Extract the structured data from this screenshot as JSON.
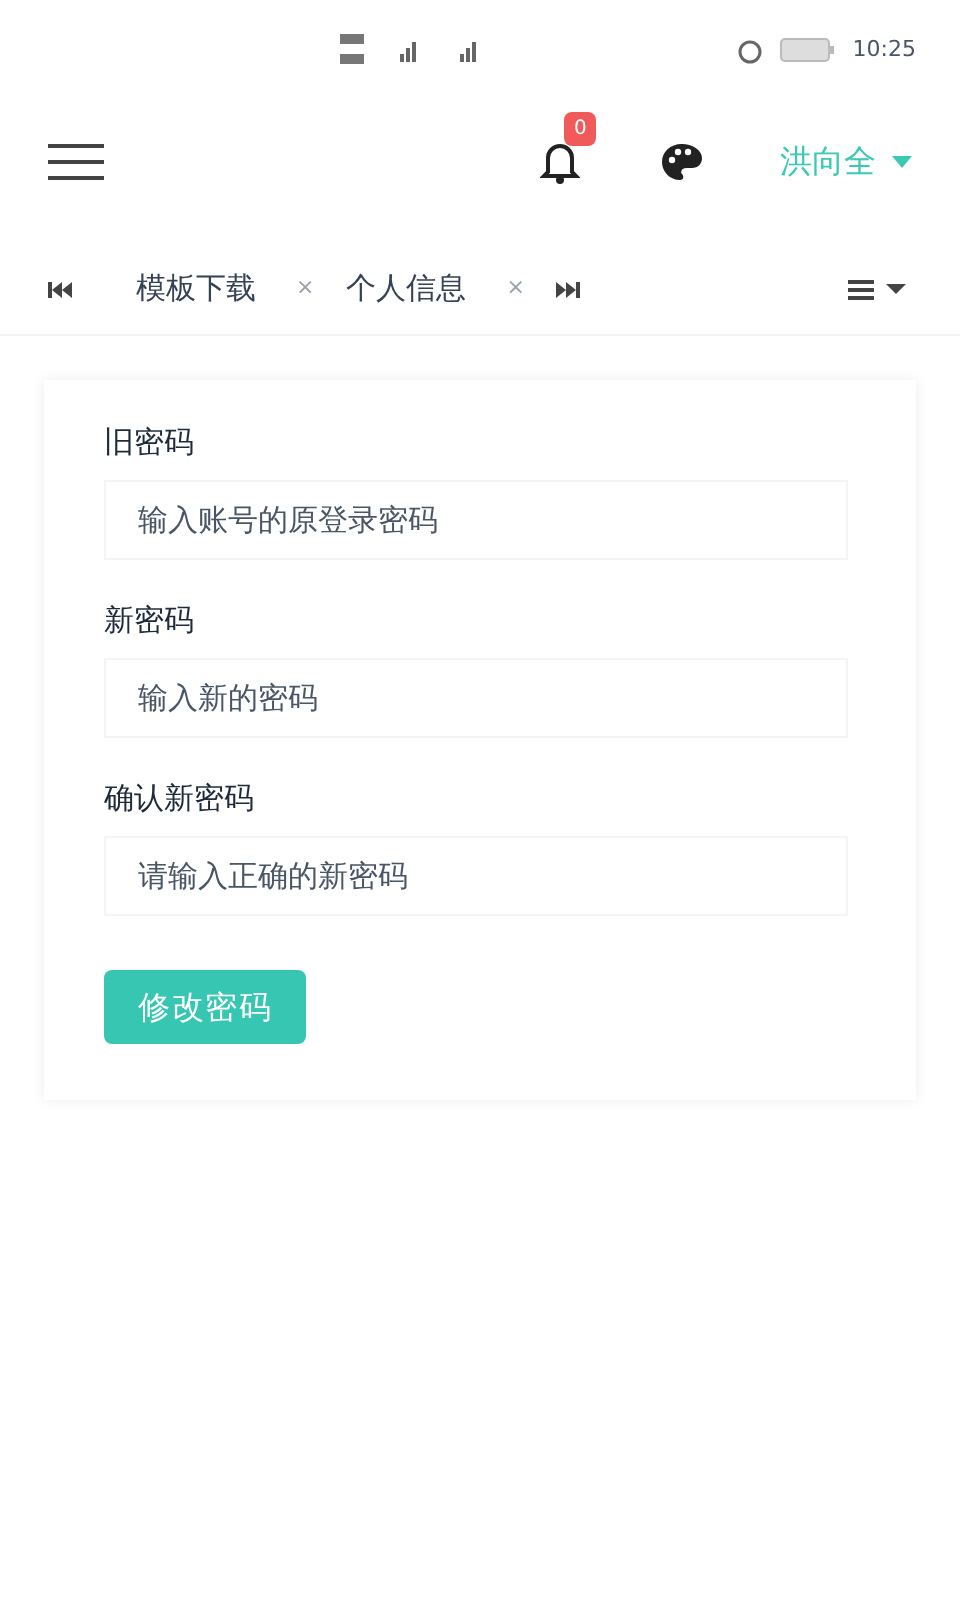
{
  "status_bar": {
    "time": "10:25"
  },
  "header": {
    "notification_count": "0",
    "user": "洪向全"
  },
  "tabs": [
    {
      "label": "模板下载",
      "close": "×"
    },
    {
      "label": "个人信息",
      "close": "×"
    }
  ],
  "form": {
    "fields": [
      {
        "label": "旧密码",
        "placeholder": "输入账号的原登录密码"
      },
      {
        "label": "新密码",
        "placeholder": "输入新的密码"
      },
      {
        "label": "确认新密码",
        "placeholder": "请输入正确的新密码"
      }
    ],
    "submit": "修改密码"
  }
}
